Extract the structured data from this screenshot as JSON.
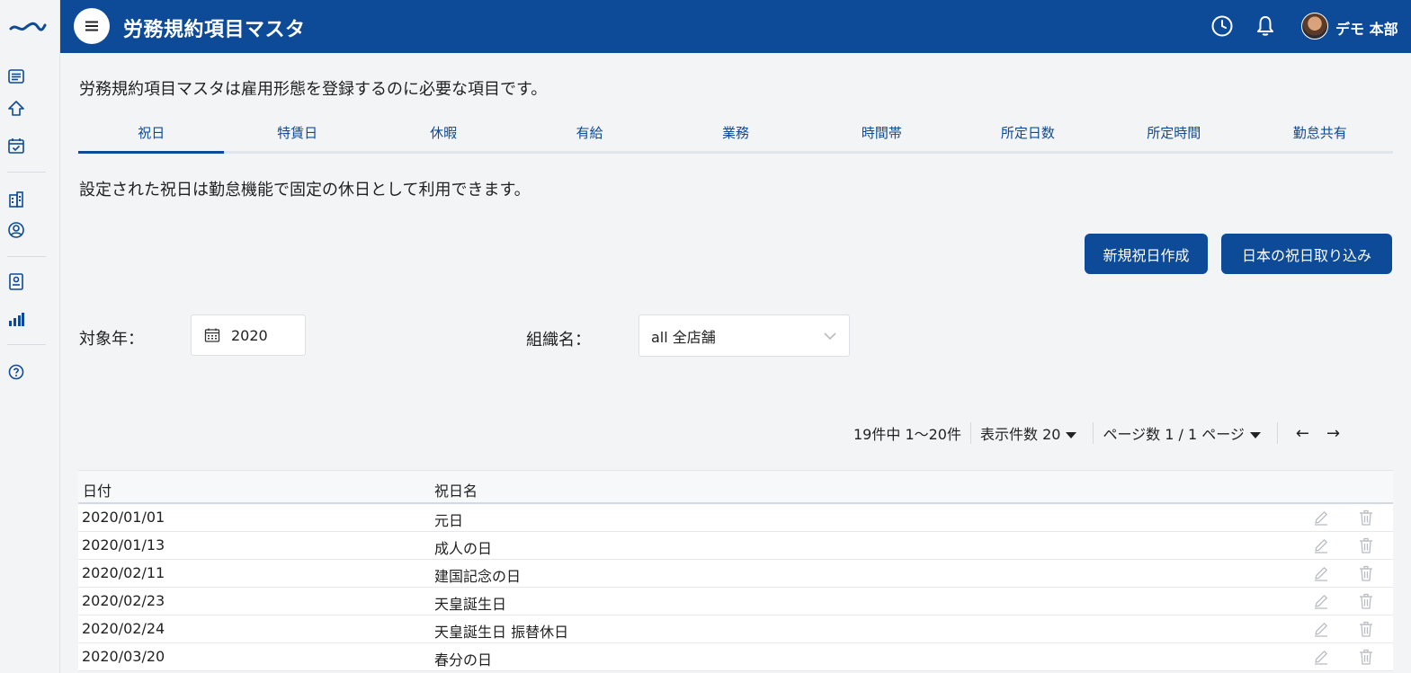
{
  "sidebar": {
    "icons": [
      "logo-wave-icon",
      "list-icon",
      "home-icon",
      "calendar-check-icon",
      "building-icon",
      "user-circle-icon",
      "id-badge-icon",
      "bar-chart-icon",
      "help-icon"
    ]
  },
  "header": {
    "title": "労務規約項目マスタ",
    "user_name": "デモ 本部"
  },
  "main": {
    "intro": "労務規約項目マスタは雇用形態を登録するのに必要な項目です。",
    "tabs": [
      {
        "label": "祝日"
      },
      {
        "label": "特賃日"
      },
      {
        "label": "休暇"
      },
      {
        "label": "有給"
      },
      {
        "label": "業務"
      },
      {
        "label": "時間帯"
      },
      {
        "label": "所定日数"
      },
      {
        "label": "所定時間"
      },
      {
        "label": "勤怠共有"
      }
    ],
    "description": "設定された祝日は勤怠機能で固定の休日として利用できます。",
    "buttons": {
      "new_holiday": "新規祝日作成",
      "import_japan": "日本の祝日取り込み"
    },
    "filters": {
      "year_label": "対象年：",
      "year_value": "2020",
      "org_label": "組織名：",
      "org_value": "all 全店舗"
    },
    "pagination": {
      "summary": "19件中 1〜20件",
      "per_page": "表示件数 20",
      "page": "ページ数 1 / 1 ページ",
      "prev": "←",
      "next": "→"
    },
    "table": {
      "headers": {
        "date": "日付",
        "name": "祝日名"
      },
      "rows": [
        {
          "date": "2020/01/01",
          "name": "元日"
        },
        {
          "date": "2020/01/13",
          "name": "成人の日"
        },
        {
          "date": "2020/02/11",
          "name": "建国記念の日"
        },
        {
          "date": "2020/02/23",
          "name": "天皇誕生日"
        },
        {
          "date": "2020/02/24",
          "name": "天皇誕生日 振替休日"
        },
        {
          "date": "2020/03/20",
          "name": "春分の日"
        }
      ]
    }
  },
  "colors": {
    "primary": "#0d4a98",
    "background": "#f3f4f6",
    "icon_muted": "#b9bcc2"
  }
}
